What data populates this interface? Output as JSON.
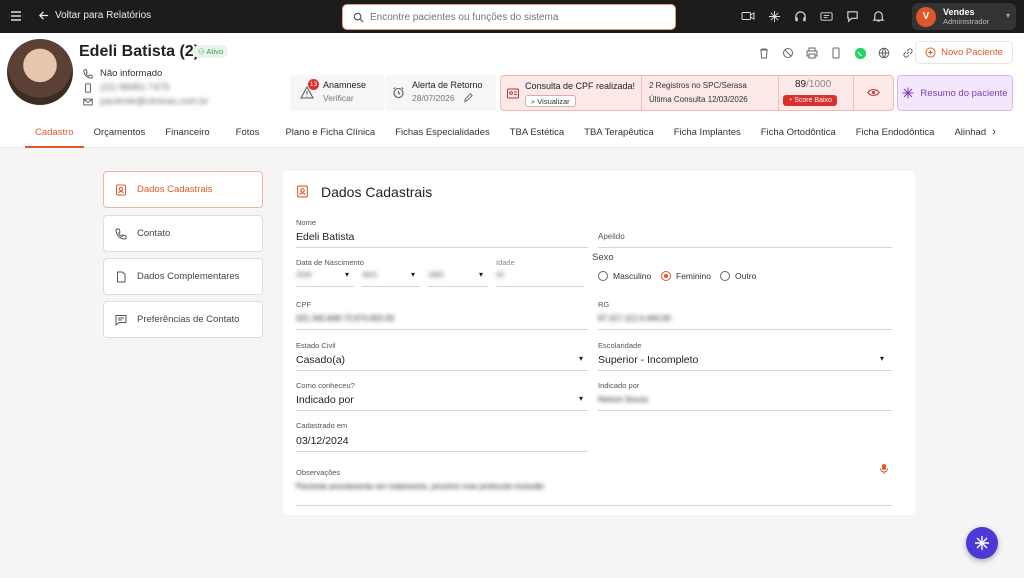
{
  "topbar": {
    "back_label": "Voltar para Relatórios",
    "search_placeholder": "Encontre pacientes ou funções do sistema",
    "icons": [
      "video-icon",
      "sparkle-icon",
      "headset-icon",
      "megaphone-icon",
      "chat-icon",
      "bell-icon"
    ],
    "user": {
      "initial": "V",
      "name": "Vendes",
      "role": "Administrador"
    }
  },
  "patient": {
    "name": "Edeli Batista (2)",
    "status": "Ativo",
    "phone": "Não informado",
    "mobile": "(11) 98481-7475",
    "email": "paciente@clinicas.com.br"
  },
  "header_actions": {
    "icons": [
      "trash-icon",
      "block-icon",
      "print-icon",
      "mobile-icon",
      "whatsapp-icon",
      "globe-icon",
      "link-icon"
    ],
    "new_patient": "Novo Paciente"
  },
  "cards": {
    "anamnese": {
      "badge": "13",
      "title": "Anamnese",
      "sub": "Verificar"
    },
    "alerta": {
      "title": "Alerta de Retorno",
      "date": "28/07/2026"
    },
    "cpf": {
      "title": "Consulta de CPF realizada!",
      "view": "Visualizar",
      "registros": "2 Registros no SPC/Serasa",
      "ultima": "Última Consulta 12/03/2026",
      "score": "89",
      "score_max": "/1000",
      "score_label": "Score Baixo"
    },
    "resumo": "Resumo do paciente"
  },
  "tabs": [
    "Cadastro",
    "Orçamentos",
    "Financeiro",
    "Fotos",
    "Plano e Ficha Clínica",
    "Fichas Especialidades",
    "TBA Estética",
    "TBA Terapêutica",
    "Ficha Implantes",
    "Ficha Ortodôntica",
    "Ficha Endodôntica",
    "Alinhad"
  ],
  "sidenav": [
    "Dados Cadastrais",
    "Contato",
    "Dados Complementares",
    "Preferências de Contato"
  ],
  "form": {
    "title": "Dados Cadastrais",
    "nome_label": "Nome",
    "nome": "Edeli Batista",
    "apelido_label": "Apelido",
    "nasc_label": "Data de Nascimento",
    "nasc_day": "2026",
    "nasc_month": "4822",
    "nasc_year": "1983",
    "idade_label": "Idade",
    "idade": "34",
    "sexo_label": "Sexo",
    "sexo_options": [
      "Masculino",
      "Feminino",
      "Outro"
    ],
    "cpf_label": "CPF",
    "cpf": "001.345.849-73.974.902.00",
    "rg_label": "RG",
    "rg": "97.317.112.4.444.00",
    "civil_label": "Estado Civil",
    "civil": "Casado(a)",
    "escol_label": "Escolaridade",
    "escol": "Superior - Incompleto",
    "como_label": "Como conheceu?",
    "como": "Indicado por",
    "indicado_label": "Indicado por",
    "indicado": "Nelson Souza",
    "cad_label": "Cadastrado em",
    "cad": "03/12/2024",
    "obs_label": "Observações",
    "obs": "Paciente previamente em tratamento, proximo mes protocolo inclusão"
  },
  "colors": {
    "accent": "#e0582a",
    "topbar": "#1c1c1c",
    "purple": "#7b3db5",
    "fab": "#4b3ad6"
  }
}
